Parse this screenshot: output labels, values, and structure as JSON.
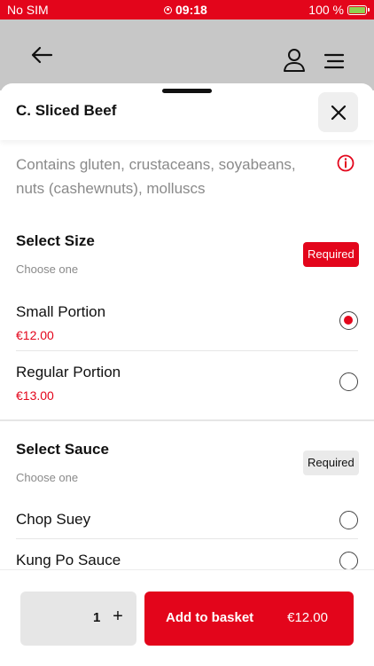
{
  "status_bar": {
    "carrier": "No SIM",
    "time": "09:18",
    "battery": "100 %"
  },
  "header": {
    "back_icon": "arrow-left-icon",
    "account_icon": "user-icon",
    "menu_icon": "hamburger-menu-icon"
  },
  "item": {
    "title": "C. Sliced Beef",
    "allergens": "Contains gluten, crustaceans, soyabeans, nuts (cashewnuts), molluscs"
  },
  "sections": [
    {
      "title": "Select Size",
      "subtitle": "Choose one",
      "badge": "Required",
      "options": [
        {
          "name": "Small Portion",
          "price": "€12.00",
          "selected": true
        },
        {
          "name": "Regular Portion",
          "price": "€13.00",
          "selected": false
        }
      ]
    },
    {
      "title": "Select Sauce",
      "subtitle": "Choose one",
      "badge": "Required",
      "options": [
        {
          "name": "Chop Suey",
          "selected": false
        },
        {
          "name": "Kung Po Sauce",
          "selected": false
        }
      ]
    }
  ],
  "footer": {
    "quantity": "1",
    "plus": "+",
    "add_label": "Add to basket",
    "add_price": "€12.00"
  },
  "colors": {
    "accent": "#e3051b",
    "muted": "#8a8a8a",
    "header_dim": "#c7c7c7"
  }
}
